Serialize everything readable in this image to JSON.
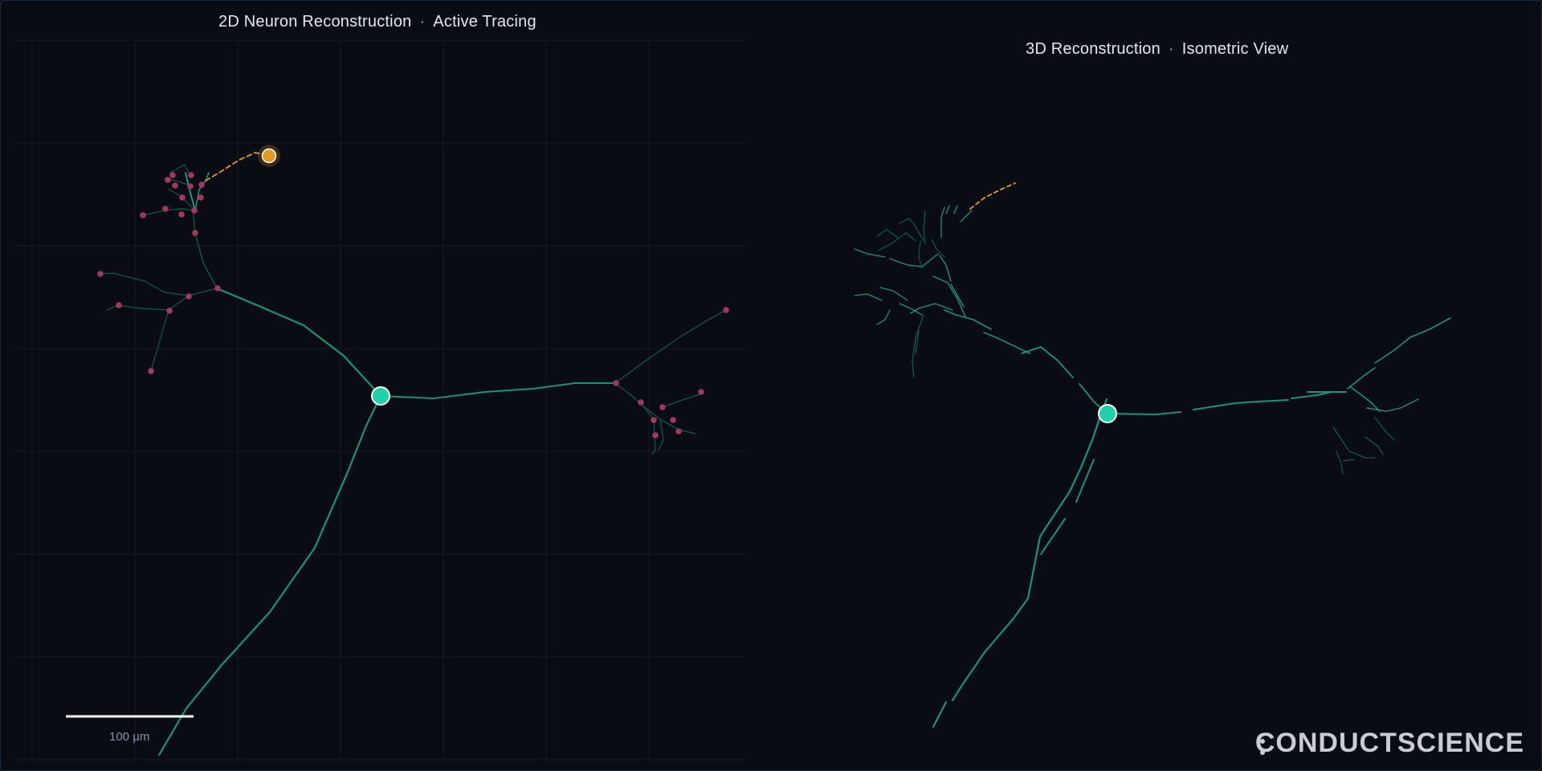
{
  "panel_2d": {
    "title": "2D Neuron Reconstruction",
    "subtitle": "Active Tracing"
  },
  "panel_3d": {
    "title": "3D Reconstruction",
    "subtitle": "Isometric View"
  },
  "separator": "·",
  "scale_bar": {
    "label": "100 μm"
  },
  "brand": {
    "name": "CONDUCTSCIENCE"
  },
  "colors": {
    "background": "#0a0c14",
    "dendrite": "#169479",
    "dendrite_dim": "#0f5a4c",
    "soma": "#1fd1a8",
    "tracing_cursor": "#e39a22",
    "branch_point": "#a3385c",
    "grid": "#141a26"
  },
  "icons": {
    "soma": "soma-node-icon",
    "cursor": "tracing-cursor-icon",
    "branch": "branch-point-icon"
  }
}
